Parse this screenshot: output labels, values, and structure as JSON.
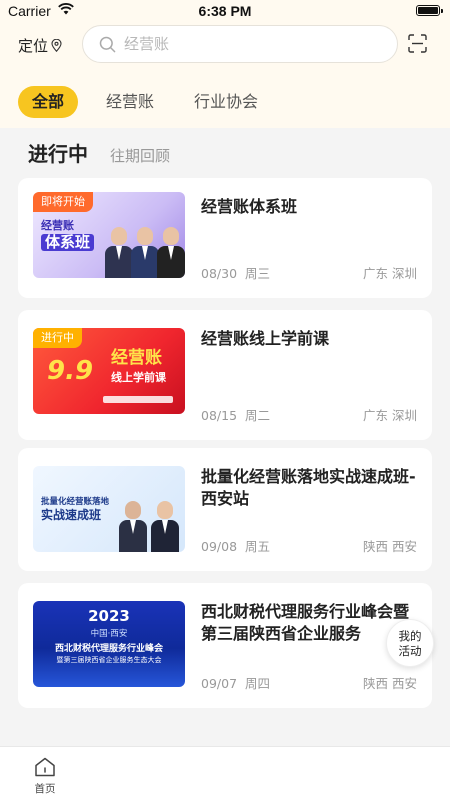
{
  "status_bar": {
    "carrier": "Carrier",
    "time": "6:38 PM"
  },
  "header": {
    "location_label": "定位",
    "search_placeholder": "经营账"
  },
  "category_tabs": [
    {
      "label": "全部",
      "active": true
    },
    {
      "label": "经营账",
      "active": false
    },
    {
      "label": "行业协会",
      "active": false
    }
  ],
  "sub_tabs": [
    {
      "label": "进行中",
      "active": true
    },
    {
      "label": "往期回顾",
      "active": false
    }
  ],
  "events": [
    {
      "title": "经营账体系班",
      "date": "08/30",
      "weekday": "周三",
      "location": "广东 深圳",
      "thumb": {
        "badge": "即将开始",
        "line1": "经营账",
        "line2": "体系班"
      }
    },
    {
      "title": "经营账线上学前课",
      "date": "08/15",
      "weekday": "周二",
      "location": "广东 深圳",
      "thumb": {
        "badge": "进行中",
        "big": "9.9",
        "line1": "经营账",
        "line2": "线上学前课"
      }
    },
    {
      "title": "批量化经营账落地实战速成班-西安站",
      "date": "09/08",
      "weekday": "周五",
      "location": "陕西 西安",
      "thumb": {
        "line1": "批量化经营账落地",
        "line2": "实战速成班"
      }
    },
    {
      "title": "西北财税代理服务行业峰会暨第三届陕西省企业服务",
      "date": "09/07",
      "weekday": "周四",
      "location": "陕西 西安",
      "thumb": {
        "year": "2023",
        "city": "中国·西安",
        "line1": "西北财税代理服务行业峰会",
        "line2": "暨第三届陕西省企业服务生态大会"
      }
    }
  ],
  "floating_button": {
    "line1": "我的",
    "line2": "活动"
  },
  "bottom_nav": {
    "home_label": "首页"
  },
  "colors": {
    "accent": "#f7c520",
    "header_bg": "#fffaf0",
    "page_bg": "#f4f4f4"
  }
}
